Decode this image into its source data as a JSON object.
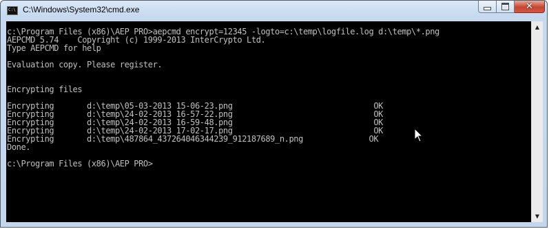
{
  "window": {
    "title": "C:\\Windows\\System32\\cmd.exe",
    "icon_label": "C:\\"
  },
  "caption_buttons": {
    "minimize": "minimize-icon",
    "maximize": "maximize-icon",
    "close": "close-icon"
  },
  "console": {
    "background": "#000000",
    "foreground": "#c0c0c0",
    "lines": [
      "c:\\Program Files (x86)\\AEP PRO>aepcmd encrypt=12345 -logto=c:\\temp\\logfile.log d:\\temp\\*.png",
      "AEPCMD 5.74    Copyright (c) 1999-2013 InterCrypto Ltd.",
      "Type AEPCMD for help",
      "",
      "Evaluation copy. Please register.",
      "",
      "",
      "Encrypting files",
      "",
      "Encrypting       d:\\temp\\05-03-2013 15-06-23.png                              OK",
      "Encrypting       d:\\temp\\24-02-2013 16-57-22.png                              OK",
      "Encrypting       d:\\temp\\24-02-2013 16-59-48.png                              OK",
      "Encrypting       d:\\temp\\24-02-2013 17-02-17.png                              OK",
      "Encrypting       d:\\temp\\487864_437264046344239_912187689_n.png              OK",
      "Done.",
      "",
      "c:\\Program Files (x86)\\AEP PRO>"
    ]
  },
  "scrollbar": {
    "up_icon": "scroll-up-arrow-icon",
    "down_icon": "scroll-down-arrow-icon"
  }
}
